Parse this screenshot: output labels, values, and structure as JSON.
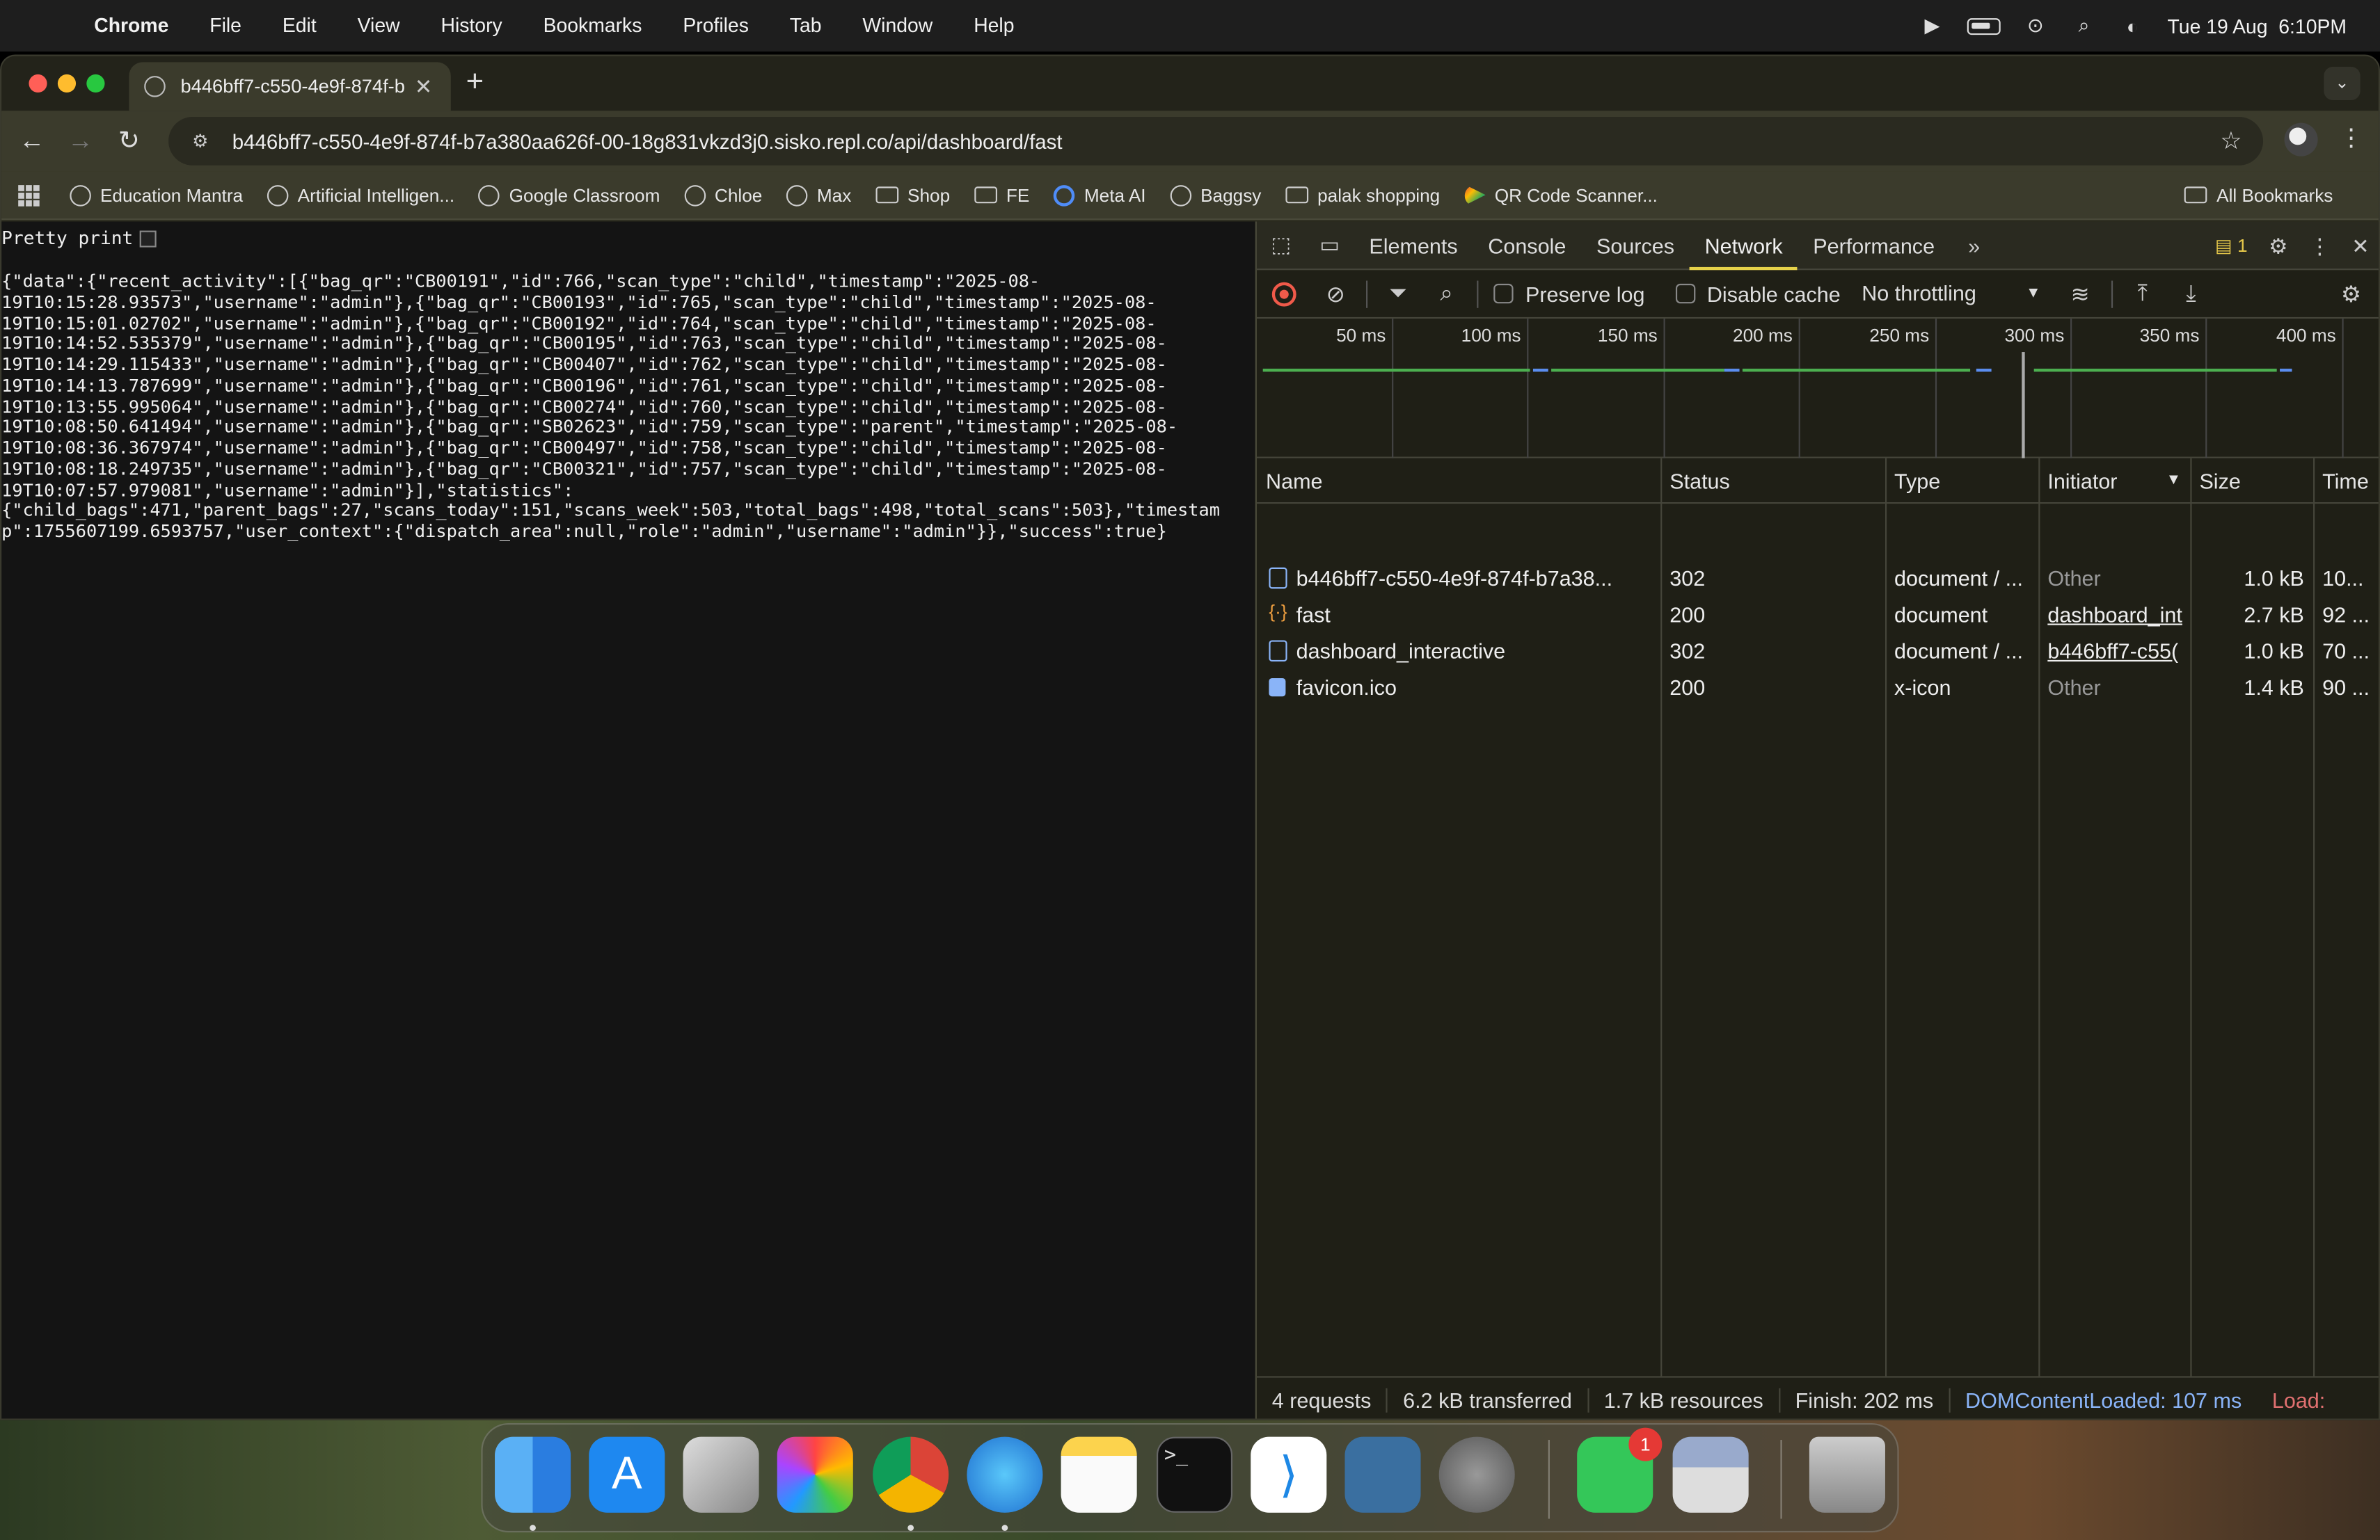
{
  "menubar": {
    "items": [
      "Chrome",
      "File",
      "Edit",
      "View",
      "History",
      "Bookmarks",
      "Profiles",
      "Tab",
      "Window",
      "Help"
    ],
    "clock": "Tue 19 Aug  6:10PM"
  },
  "browser": {
    "tab_title": "b446bff7-c550-4e9f-874f-b",
    "url": "b446bff7-c550-4e9f-874f-b7a380aa626f-00-18g831vkzd3j0.sisko.repl.co/api/dashboard/fast",
    "bookmarks": [
      "Education Mantra",
      "Artificial Intelligen...",
      "Google Classroom",
      "Chloe",
      "Max",
      "Shop",
      "FE",
      "Meta AI",
      "Baggsy",
      "palak shopping",
      "QR Code Scanner..."
    ],
    "all_bookmarks": "All Bookmarks"
  },
  "page": {
    "pretty_print": "Pretty print",
    "json_lines": [
      "{\"data\":{\"recent_activity\":[{\"bag_qr\":\"CB00191\",\"id\":766,\"scan_type\":\"child\",\"timestamp\":\"2025-08-",
      "19T10:15:28.93573\",\"username\":\"admin\"},{\"bag_qr\":\"CB00193\",\"id\":765,\"scan_type\":\"child\",\"timestamp\":\"2025-08-",
      "19T10:15:01.02702\",\"username\":\"admin\"},{\"bag_qr\":\"CB00192\",\"id\":764,\"scan_type\":\"child\",\"timestamp\":\"2025-08-",
      "19T10:14:52.535379\",\"username\":\"admin\"},{\"bag_qr\":\"CB00195\",\"id\":763,\"scan_type\":\"child\",\"timestamp\":\"2025-08-",
      "19T10:14:29.115433\",\"username\":\"admin\"},{\"bag_qr\":\"CB00407\",\"id\":762,\"scan_type\":\"child\",\"timestamp\":\"2025-08-",
      "19T10:14:13.787699\",\"username\":\"admin\"},{\"bag_qr\":\"CB00196\",\"id\":761,\"scan_type\":\"child\",\"timestamp\":\"2025-08-",
      "19T10:13:55.995064\",\"username\":\"admin\"},{\"bag_qr\":\"CB00274\",\"id\":760,\"scan_type\":\"child\",\"timestamp\":\"2025-08-",
      "19T10:08:50.641494\",\"username\":\"admin\"},{\"bag_qr\":\"SB02623\",\"id\":759,\"scan_type\":\"parent\",\"timestamp\":\"2025-08-",
      "19T10:08:36.367974\",\"username\":\"admin\"},{\"bag_qr\":\"CB00497\",\"id\":758,\"scan_type\":\"child\",\"timestamp\":\"2025-08-",
      "19T10:08:18.249735\",\"username\":\"admin\"},{\"bag_qr\":\"CB00321\",\"id\":757,\"scan_type\":\"child\",\"timestamp\":\"2025-08-",
      "19T10:07:57.979081\",\"username\":\"admin\"}],\"statistics\":",
      "{\"child_bags\":471,\"parent_bags\":27,\"scans_today\":151,\"scans_week\":503,\"total_bags\":498,\"total_scans\":503},\"timestam",
      "p\":1755607199.6593757,\"user_context\":{\"dispatch_area\":null,\"role\":\"admin\",\"username\":\"admin\"}},\"success\":true}"
    ]
  },
  "devtools": {
    "tabs": [
      "Elements",
      "Console",
      "Sources",
      "Network",
      "Performance"
    ],
    "active_tab": "Network",
    "message_count": "1",
    "preserve_log": "Preserve log",
    "disable_cache": "Disable cache",
    "throttling": "No throttling",
    "timeline_ticks": [
      "50 ms",
      "100 ms",
      "150 ms",
      "200 ms",
      "250 ms",
      "300 ms",
      "350 ms",
      "400 ms"
    ],
    "columns": [
      "Name",
      "Status",
      "Type",
      "Initiator",
      "Size",
      "Time"
    ],
    "rows": [
      {
        "name": "b446bff7-c550-4e9f-874f-b7a38...",
        "status": "302",
        "type": "document / ...",
        "initiator": "Other",
        "size": "1.0 kB",
        "time": "10..."
      },
      {
        "name": "fast",
        "status": "200",
        "type": "document",
        "initiator": "dashboard_int",
        "size": "2.7 kB",
        "time": "92 ..."
      },
      {
        "name": "dashboard_interactive",
        "status": "302",
        "type": "document / ...",
        "initiator": "b446bff7-c55(",
        "size": "1.0 kB",
        "time": "70 ..."
      },
      {
        "name": "favicon.ico",
        "status": "200",
        "type": "x-icon",
        "initiator": "Other",
        "size": "1.4 kB",
        "time": "90 ..."
      }
    ],
    "status_bar": {
      "requests": "4 requests",
      "transferred": "6.2 kB transferred",
      "resources": "1.7 kB resources",
      "finish": "Finish: 202 ms",
      "dcl": "DOMContentLoaded: 107 ms",
      "load": "Load:"
    }
  },
  "dock": {
    "apps": [
      "finder-icon",
      "app-store-icon",
      "launchpad-icon",
      "photos-icon",
      "chrome-icon",
      "safari-icon",
      "notes-icon",
      "terminal-icon",
      "vscode-icon",
      "postgres-icon",
      "system-settings-icon",
      "facetime-icon",
      "preview-icon",
      "trash-icon"
    ],
    "facetime_badge": "1"
  }
}
